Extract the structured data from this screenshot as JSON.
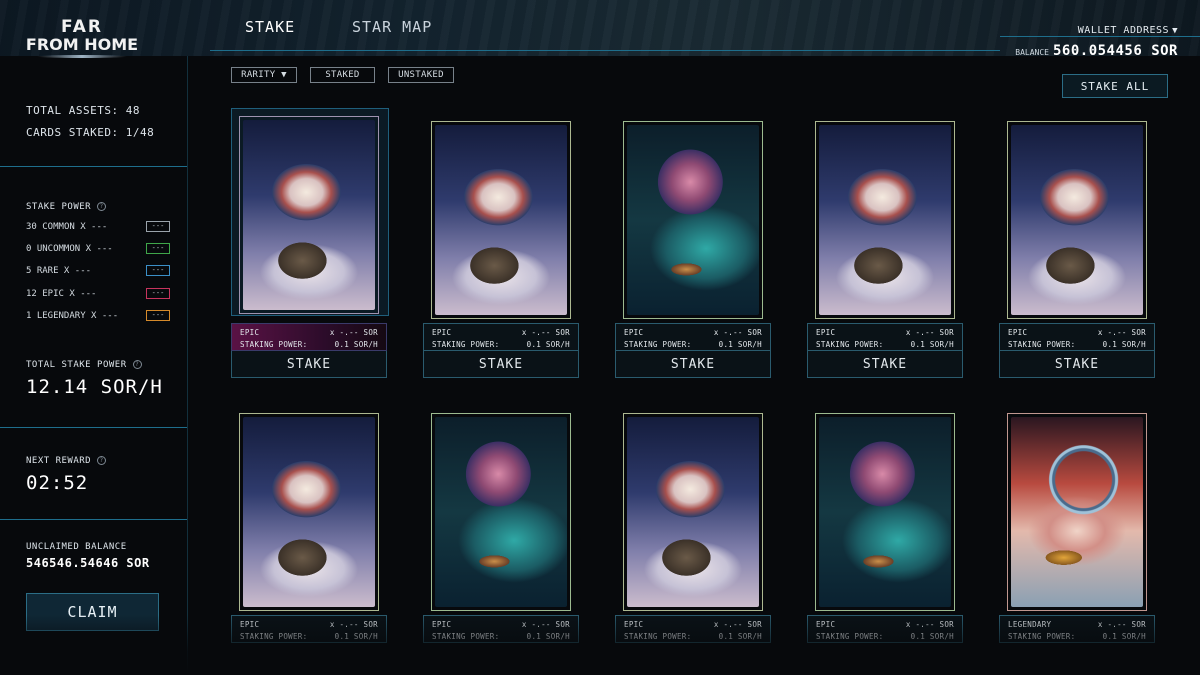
{
  "app": {
    "logo_line1": "FAR",
    "logo_line2": "FROM HOME",
    "accent_color": "#1e6e8c"
  },
  "nav": {
    "tabs": [
      {
        "label": "STAKE",
        "active": true
      },
      {
        "label": "STAR MAP",
        "active": false
      }
    ]
  },
  "wallet": {
    "label": "WALLET ADDRESS",
    "balance_label": "BALANCE",
    "balance_value": "560.054456 SOR",
    "dropdown_icon": "caret-down-icon"
  },
  "sidebar": {
    "total_assets": "TOTAL ASSETS: 48",
    "cards_staked": "CARDS STAKED: 1/48",
    "stake_power_label": "STAKE POWER",
    "stake_power_rows": [
      {
        "count": "30",
        "label": "COMMON X ---",
        "box": "---",
        "color": "#9aa3ab"
      },
      {
        "count": "0",
        "label": "UNCOMMON X ---",
        "box": "---",
        "color": "#3fa64a"
      },
      {
        "count": "5",
        "label": "RARE X ---",
        "box": "---",
        "color": "#3b8fc7"
      },
      {
        "count": "12",
        "label": "EPIC X ---",
        "box": "---",
        "color": "#c7345e"
      },
      {
        "count": "1",
        "label": "LEGENDARY X ---",
        "box": "---",
        "color": "#d58a2b"
      }
    ],
    "total_stake_power_label": "TOTAL STAKE POWER",
    "total_stake_power_value": "12.14 SOR/H",
    "next_reward_label": "NEXT REWARD",
    "next_reward_value": "02:52",
    "unclaimed_label": "UNCLAIMED BALANCE",
    "unclaimed_value": "546546.54646 SOR",
    "claim_label": "CLAIM",
    "info_icon": "info-icon"
  },
  "filters": {
    "rarity": "RARITY",
    "staked": "STAKED",
    "unstaked": "UNSTAKED",
    "stake_all": "STAKE ALL"
  },
  "cards": [
    {
      "rarity": "EPIC",
      "price": "x -.-- SOR",
      "power_label": "STAKING POWER:",
      "power": "0.1 SOR/H",
      "action": "STAKE",
      "art": "ship-nebula",
      "selected": true
    },
    {
      "rarity": "EPIC",
      "price": "x -.-- SOR",
      "power_label": "STAKING POWER:",
      "power": "0.1 SOR/H",
      "action": "STAKE",
      "art": "ship-nebula",
      "selected": false
    },
    {
      "rarity": "EPIC",
      "price": "x -.-- SOR",
      "power_label": "STAKING POWER:",
      "power": "0.1 SOR/H",
      "action": "STAKE",
      "art": "planet-ship",
      "selected": false
    },
    {
      "rarity": "EPIC",
      "price": "x -.-- SOR",
      "power_label": "STAKING POWER:",
      "power": "0.1 SOR/H",
      "action": "STAKE",
      "art": "ship-nebula",
      "selected": false
    },
    {
      "rarity": "EPIC",
      "price": "x -.-- SOR",
      "power_label": "STAKING POWER:",
      "power": "0.1 SOR/H",
      "action": "STAKE",
      "art": "ship-nebula",
      "selected": false
    },
    {
      "rarity": "EPIC",
      "price": "x -.-- SOR",
      "power_label": "STAKING POWER:",
      "power": "0.1 SOR/H",
      "art": "ship-nebula"
    },
    {
      "rarity": "EPIC",
      "price": "x -.-- SOR",
      "power_label": "STAKING POWER:",
      "power": "0.1 SOR/H",
      "art": "planet-ship"
    },
    {
      "rarity": "EPIC",
      "price": "x -.-- SOR",
      "power_label": "STAKING POWER:",
      "power": "0.1 SOR/H",
      "art": "ship-nebula"
    },
    {
      "rarity": "EPIC",
      "price": "x -.-- SOR",
      "power_label": "STAKING POWER:",
      "power": "0.1 SOR/H",
      "art": "planet-ship"
    },
    {
      "rarity": "LEGENDARY",
      "price": "x -.-- SOR",
      "power_label": "STAKING POWER:",
      "power": "0.1 SOR/H",
      "art": "portal-ship"
    }
  ]
}
